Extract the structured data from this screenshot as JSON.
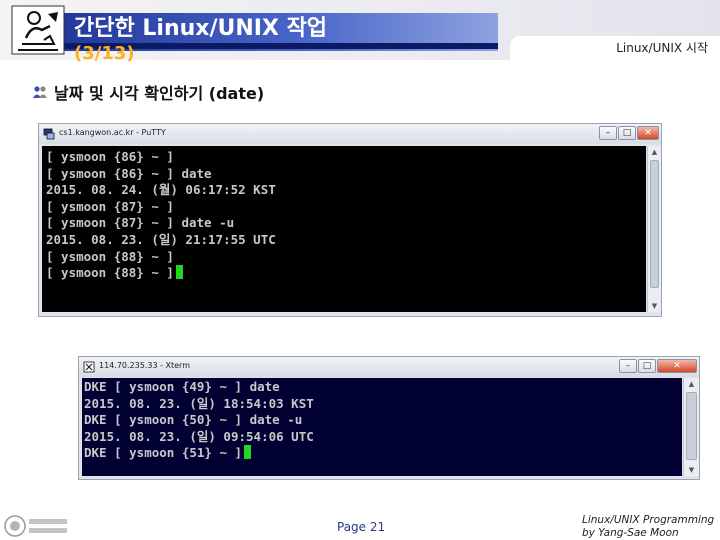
{
  "slide": {
    "title": "간단한 Linux/UNIX 작업",
    "subtitle": "(3/13)",
    "section": "Linux/UNIX 시작",
    "bullet": "날짜 및 시각 확인하기 (date)",
    "page": "Page 21",
    "credit_line1": "Linux/UNIX Programming",
    "credit_line2": "by Yang-Sae Moon"
  },
  "putty": {
    "title": "cs1.kangwon.ac.kr - PuTTY",
    "buttons": {
      "minimize": "–",
      "maximize": "□",
      "close": "✕"
    },
    "lines": [
      "[ ysmoon {86} ~ ]",
      "[ ysmoon {86} ~ ] date",
      "2015. 08. 24. (월) 06:17:52 KST",
      "[ ysmoon {87} ~ ]",
      "[ ysmoon {87} ~ ] date -u",
      "2015. 08. 23. (일) 21:17:55 UTC",
      "[ ysmoon {88} ~ ]",
      "[ ysmoon {88} ~ ]"
    ]
  },
  "xterm": {
    "title": "114.70.235.33 - Xterm",
    "buttons": {
      "minimize": "–",
      "maximize": "□",
      "close": "✕"
    },
    "lines": [
      "DKE [ ysmoon {49} ~ ] date",
      "2015. 08. 23. (일) 18:54:03 KST",
      "DKE [ ysmoon {50} ~ ] date -u",
      "2015. 08. 23. (일) 09:54:06 UTC",
      "DKE [ ysmoon {51} ~ ]"
    ]
  },
  "colors": {
    "title_band": "#1b2f90",
    "subtitle": "#ffb020",
    "cursor": "#22d622",
    "terminal_text": "#c8c8c8"
  }
}
